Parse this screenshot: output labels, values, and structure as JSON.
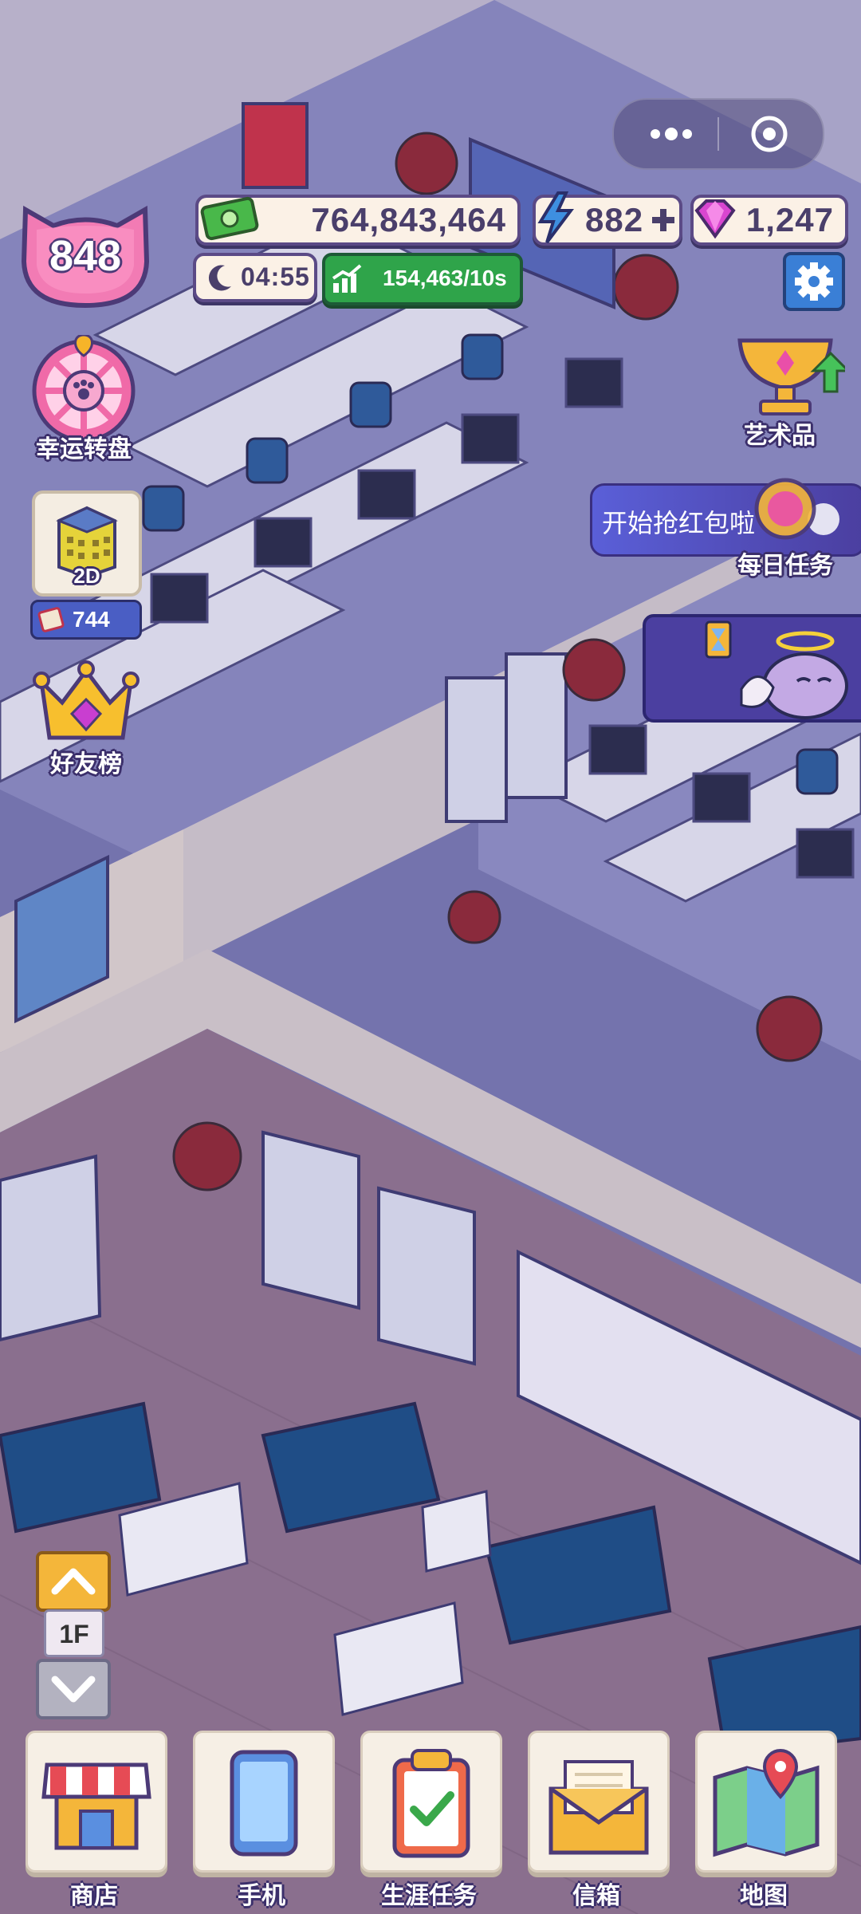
{
  "level": "848",
  "money": "764,843,464",
  "energy": "882",
  "gems": "1,247",
  "time": "04:55",
  "income": "154,463/10s",
  "left_menu": {
    "lucky_wheel": "幸运转盘",
    "view_mode": "2D",
    "tickets": "744",
    "friends_rank": "好友榜"
  },
  "right_menu": {
    "artwork": "艺术品",
    "red_packet": "开始抢红包啦",
    "daily_tasks": "每日任务"
  },
  "floor": {
    "current": "1F"
  },
  "bottom_nav": [
    {
      "label": "商店",
      "icon": "shop-icon"
    },
    {
      "label": "手机",
      "icon": "phone-icon"
    },
    {
      "label": "生涯任务",
      "icon": "clipboard-icon"
    },
    {
      "label": "信箱",
      "icon": "mail-icon"
    },
    {
      "label": "地图",
      "icon": "map-icon"
    }
  ],
  "colors": {
    "accent_green": "#3aa84a",
    "pink": "#f07fb5",
    "navy": "#5b4a86",
    "purple_banner": "#4b3fa0"
  }
}
